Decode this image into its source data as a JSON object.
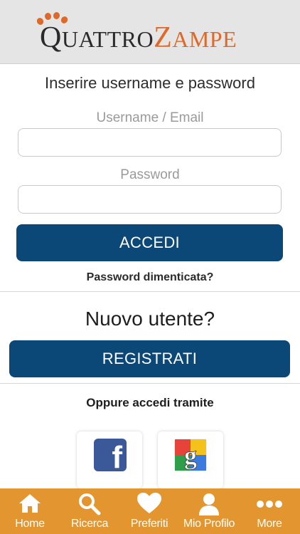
{
  "header": {
    "logo_part1": "Quattro",
    "logo_part2": "Zampe"
  },
  "login": {
    "intro": "Inserire username e password",
    "username_label": "Username / Email",
    "username_value": "",
    "password_label": "Password",
    "password_value": "",
    "login_button": "ACCEDI",
    "forgot_password": "Password dimenticata?"
  },
  "register": {
    "title": "Nuovo utente?",
    "button": "REGISTRATI"
  },
  "social": {
    "title": "Oppure accedi tramite",
    "facebook_icon": "facebook-icon",
    "google_icon": "google-icon"
  },
  "tabbar": {
    "items": [
      {
        "label": "Home",
        "icon": "home-icon"
      },
      {
        "label": "Ricerca",
        "icon": "search-icon"
      },
      {
        "label": "Preferiti",
        "icon": "heart-icon"
      },
      {
        "label": "Mio Profilo",
        "icon": "user-icon"
      },
      {
        "label": "More",
        "icon": "more-icon"
      }
    ]
  },
  "colors": {
    "header_bg": "#e5e5e5",
    "brand_orange": "#dd6a2a",
    "button_blue": "#0b4878",
    "tabbar_bg": "#e3962f"
  }
}
